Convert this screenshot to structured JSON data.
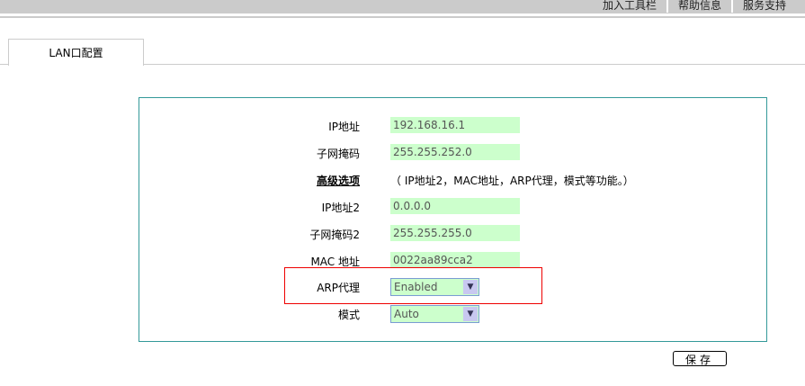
{
  "top_links": [
    "加入工具栏",
    "帮助信息",
    "服务支持"
  ],
  "tab": "LAN口配置",
  "fields": {
    "ip": {
      "label": "IP地址",
      "value": "192.168.16.1"
    },
    "mask": {
      "label": "子网掩码",
      "value": "255.255.252.0"
    },
    "advanced": {
      "label": "高级选项",
      "desc": "（ IP地址2，MAC地址，ARP代理，模式等功能。）"
    },
    "ip2": {
      "label": "IP地址2",
      "value": "0.0.0.0"
    },
    "mask2": {
      "label": "子网掩码2",
      "value": "255.255.255.0"
    },
    "mac": {
      "label": "MAC 地址",
      "value": "0022aa89cca2"
    },
    "arp": {
      "label": "ARP代理",
      "value": "Enabled"
    },
    "mode": {
      "label": "模式",
      "value": "Auto"
    }
  },
  "save_label": "保存"
}
